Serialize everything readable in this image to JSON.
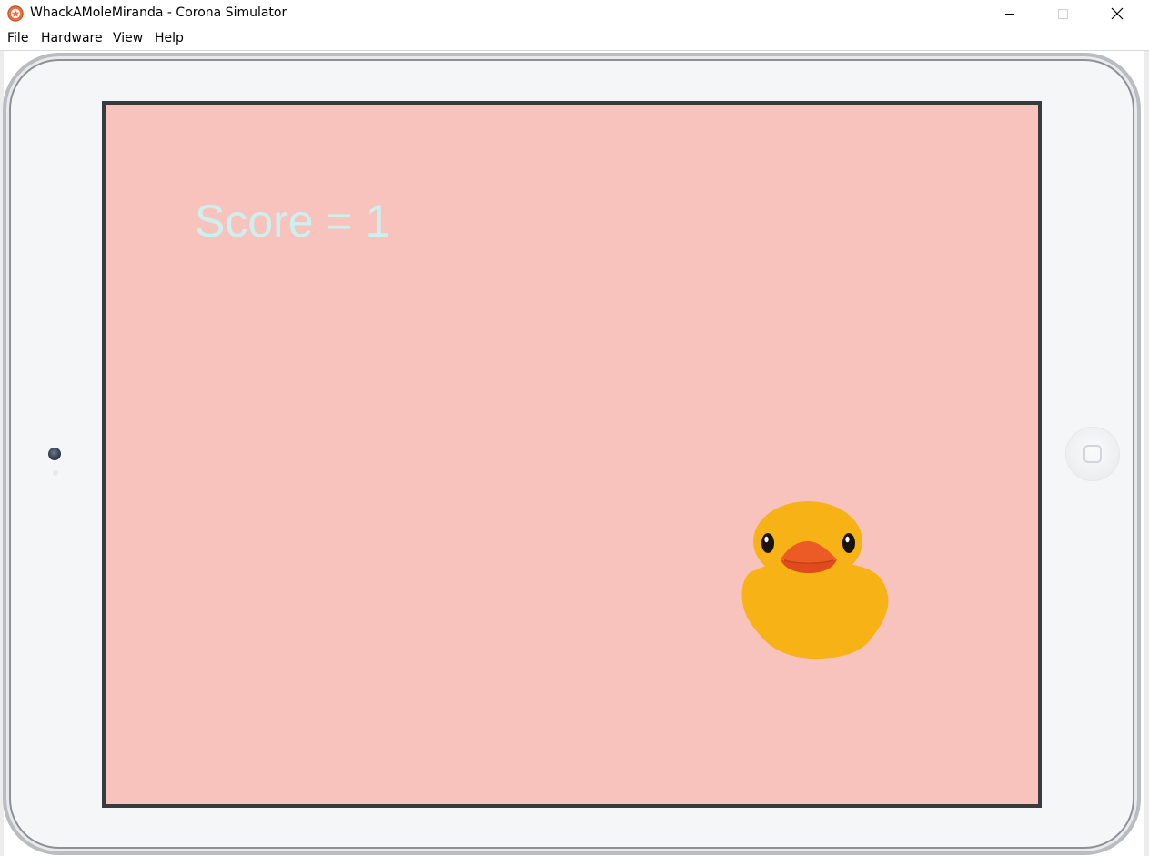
{
  "window": {
    "title": "WhackAMoleMiranda - Corona Simulator",
    "app_icon": "corona-simulator-icon",
    "controls": [
      "minimize-icon",
      "maximize-icon",
      "close-icon"
    ]
  },
  "menubar": {
    "items": [
      {
        "label": "File"
      },
      {
        "label": "Hardware"
      },
      {
        "label": "View"
      },
      {
        "label": "Help"
      }
    ]
  },
  "device": {
    "type": "ipad-landscape-frame",
    "home_button_icon": "home-button-icon",
    "camera_icon": "camera-icon"
  },
  "game": {
    "score_text": "Score = 1",
    "background_color": "#f8c3bc",
    "score_color": "#ccf0f0",
    "mole_icon": "rubber-duck-icon",
    "duck_body_color": "#f7b215",
    "duck_beak_color": "#ec5b25"
  }
}
